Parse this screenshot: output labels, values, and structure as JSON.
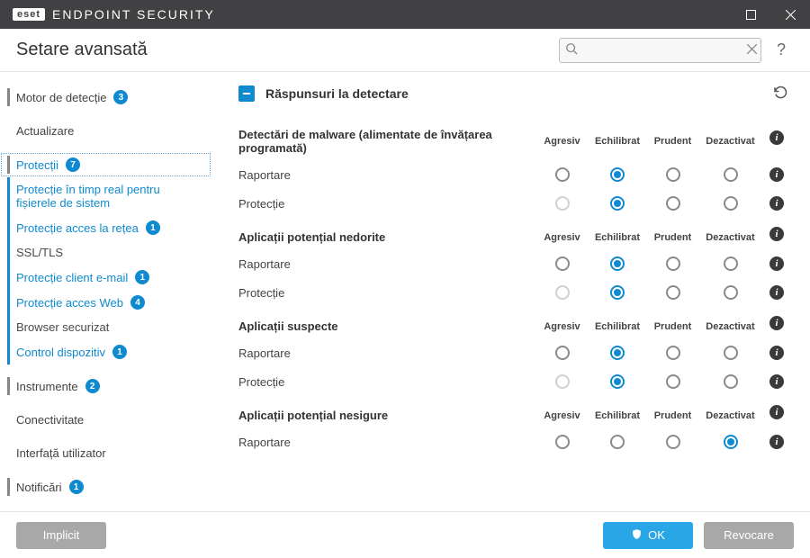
{
  "titlebar": {
    "brand_box": "eset",
    "product": "ENDPOINT SECURITY"
  },
  "subheader": {
    "title": "Setare avansată",
    "search_placeholder": "",
    "help": "?"
  },
  "sidebar": {
    "items": [
      {
        "label": "Motor de detecție",
        "badge": "3",
        "bar": true,
        "active": false
      },
      {
        "label": "Actualizare",
        "bar": false,
        "active": false
      },
      {
        "label": "Protecții",
        "badge": "7",
        "bar": true,
        "active": true,
        "selected": true
      },
      {
        "label": "Protecție în timp real pentru fișierele de sistem",
        "sub": true
      },
      {
        "label": "Protecție acces la rețea",
        "badge": "1",
        "sub": true
      },
      {
        "label": "SSL/TLS",
        "sub": true,
        "dim": true
      },
      {
        "label": "Protecție client e-mail",
        "badge": "1",
        "sub": true
      },
      {
        "label": "Protecție acces Web",
        "badge": "4",
        "sub": true
      },
      {
        "label": "Browser securizat",
        "sub": true,
        "dim": true
      },
      {
        "label": "Control dispozitiv",
        "badge": "1",
        "sub": true
      },
      {
        "label": "Instrumente",
        "badge": "2",
        "bar": true
      },
      {
        "label": "Conectivitate",
        "bar": false
      },
      {
        "label": "Interfață utilizator",
        "bar": false
      },
      {
        "label": "Notificări",
        "badge": "1",
        "bar": true
      }
    ]
  },
  "content": {
    "section_title": "Răspunsuri la detectare",
    "columns": [
      "Agresiv",
      "Echilibrat",
      "Prudent",
      "Dezactivat"
    ],
    "groups": [
      {
        "title": "Detectări de malware (alimentate de învățarea programată)",
        "rows": [
          {
            "label": "Raportare",
            "selected": 1,
            "disabled": []
          },
          {
            "label": "Protecție",
            "selected": 1,
            "disabled": [
              0
            ]
          }
        ]
      },
      {
        "title": "Aplicații potențial nedorite",
        "rows": [
          {
            "label": "Raportare",
            "selected": 1,
            "disabled": []
          },
          {
            "label": "Protecție",
            "selected": 1,
            "disabled": [
              0
            ]
          }
        ]
      },
      {
        "title": "Aplicații suspecte",
        "rows": [
          {
            "label": "Raportare",
            "selected": 1,
            "disabled": []
          },
          {
            "label": "Protecție",
            "selected": 1,
            "disabled": [
              0
            ]
          }
        ]
      },
      {
        "title": "Aplicații potențial nesigure",
        "rows": [
          {
            "label": "Raportare",
            "selected": 3,
            "disabled": []
          }
        ]
      }
    ]
  },
  "footer": {
    "default": "Implicit",
    "ok": "OK",
    "cancel": "Revocare"
  }
}
